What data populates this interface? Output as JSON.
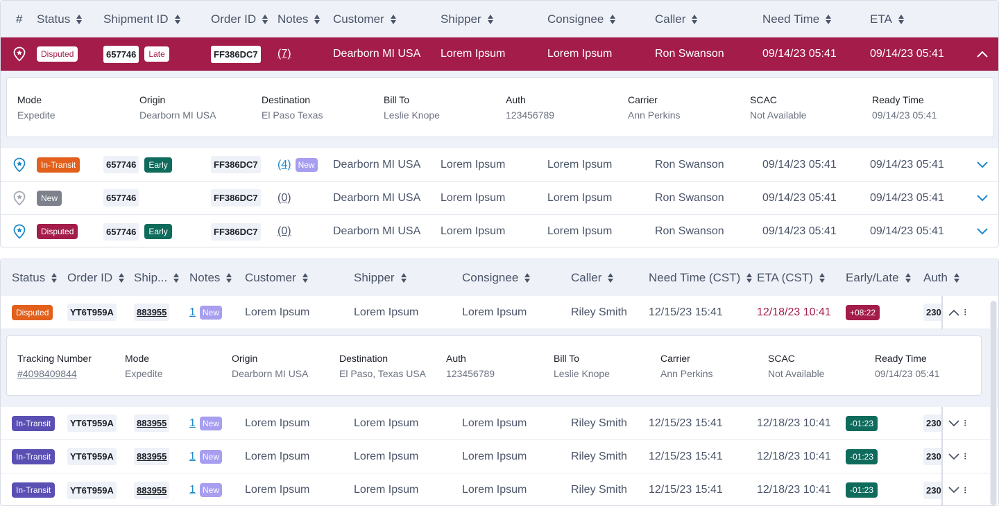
{
  "table1": {
    "headers": [
      "#",
      "Status",
      "Shipment ID",
      "Order ID",
      "Notes",
      "Customer",
      "Shipper",
      "Consignee",
      "Caller",
      "Need Time",
      "ETA"
    ],
    "rows": [
      {
        "status": "Disputed",
        "shipment_id": "657746",
        "tag": "Late",
        "order_id": "FF386DC7",
        "notes": "(7)",
        "notes_new": "",
        "customer": "Dearborn MI USA",
        "shipper": "Lorem Ipsum",
        "consignee": "Lorem Ipsum",
        "caller": "Ron Swanson",
        "need_time": "09/14/23 05:41",
        "eta": "09/14/23 05:41"
      },
      {
        "status": "In-Transit",
        "shipment_id": "657746",
        "tag": "Early",
        "order_id": "FF386DC7",
        "notes": "(4)",
        "notes_new": "New",
        "customer": "Dearborn MI USA",
        "shipper": "Lorem Ipsum",
        "consignee": "Lorem Ipsum",
        "caller": "Ron Swanson",
        "need_time": "09/14/23 05:41",
        "eta": "09/14/23 05:41"
      },
      {
        "status": "New",
        "shipment_id": "657746",
        "tag": "",
        "order_id": "FF386DC7",
        "notes": "(0)",
        "notes_new": "",
        "customer": "Dearborn MI USA",
        "shipper": "Lorem Ipsum",
        "consignee": "Lorem Ipsum",
        "caller": "Ron Swanson",
        "need_time": "09/14/23 05:41",
        "eta": "09/14/23 05:41"
      },
      {
        "status": "Disputed",
        "shipment_id": "657746",
        "tag": "Early",
        "order_id": "FF386DC7",
        "notes": "(0)",
        "notes_new": "",
        "customer": "Dearborn MI USA",
        "shipper": "Lorem Ipsum",
        "consignee": "Lorem Ipsum",
        "caller": "Ron Swanson",
        "need_time": "09/14/23 05:41",
        "eta": "09/14/23 05:41"
      }
    ],
    "detail": [
      {
        "label": "Mode",
        "value": "Expedite"
      },
      {
        "label": "Origin",
        "value": "Dearborn MI USA"
      },
      {
        "label": "Destination",
        "value": "El Paso Texas"
      },
      {
        "label": "Bill To",
        "value": "Leslie Knope"
      },
      {
        "label": "Auth",
        "value": "123456789"
      },
      {
        "label": "Carrier",
        "value": "Ann Perkins"
      },
      {
        "label": "SCAC",
        "value": "Not Available"
      },
      {
        "label": "Ready Time",
        "value": "09/14/23 05:41"
      }
    ]
  },
  "table2": {
    "headers": [
      "Status",
      "Order ID",
      "Ship...",
      "Notes",
      "Customer",
      "Shipper",
      "Consignee",
      "Caller",
      "Need Time (CST)",
      "ETA (CST)",
      "Early/Late",
      "Auth"
    ],
    "rows": [
      {
        "status": "Disputed",
        "order_id": "YT6T959A",
        "ship": "883955",
        "notes": "1",
        "notes_new": "New",
        "customer": "Lorem Ipsum",
        "shipper": "Lorem Ipsum",
        "consignee": "Lorem Ipsum",
        "caller": "Riley Smith",
        "need_time": "12/15/23 15:41",
        "eta": "12/18/23 10:41",
        "early_late": "+08:22",
        "auth": "230"
      },
      {
        "status": "In-Transit",
        "order_id": "YT6T959A",
        "ship": "883955",
        "notes": "1",
        "notes_new": "New",
        "customer": "Lorem Ipsum",
        "shipper": "Lorem Ipsum",
        "consignee": "Lorem Ipsum",
        "caller": "Riley Smith",
        "need_time": "12/15/23 15:41",
        "eta": "12/18/23 10:41",
        "early_late": "-01:23",
        "auth": "230"
      },
      {
        "status": "In-Transit",
        "order_id": "YT6T959A",
        "ship": "883955",
        "notes": "1",
        "notes_new": "New",
        "customer": "Lorem Ipsum",
        "shipper": "Lorem Ipsum",
        "consignee": "Lorem Ipsum",
        "caller": "Riley Smith",
        "need_time": "12/15/23 15:41",
        "eta": "12/18/23 10:41",
        "early_late": "-01:23",
        "auth": "230"
      },
      {
        "status": "In-Transit",
        "order_id": "YT6T959A",
        "ship": "883955",
        "notes": "1",
        "notes_new": "New",
        "customer": "Lorem Ipsum",
        "shipper": "Lorem Ipsum",
        "consignee": "Lorem Ipsum",
        "caller": "Riley Smith",
        "need_time": "12/15/23 15:41",
        "eta": "12/18/23 10:41",
        "early_late": "-01:23",
        "auth": "230"
      }
    ],
    "detail": [
      {
        "label": "Tracking Number",
        "value": "#4098409844"
      },
      {
        "label": "Mode",
        "value": "Expedite"
      },
      {
        "label": "Origin",
        "value": "Dearborn MI USA"
      },
      {
        "label": "Destination",
        "value": "El Paso, Texas USA"
      },
      {
        "label": "Auth",
        "value": "123456789"
      },
      {
        "label": "Bill To",
        "value": "Leslie Knope"
      },
      {
        "label": "Carrier",
        "value": "Ann Perkins"
      },
      {
        "label": "SCAC",
        "value": "Not Available"
      },
      {
        "label": "Ready Time",
        "value": "09/14/23 05:41"
      }
    ]
  },
  "colors": {
    "accent_red": "#a31c4a",
    "accent_blue": "#1e88c8",
    "orange": "#e2601b",
    "purple": "#5a4fb3",
    "green": "#0f6b5c"
  },
  "icons": [
    "location-pin-icon",
    "chevron-up-icon",
    "chevron-down-icon",
    "sort-icon"
  ]
}
